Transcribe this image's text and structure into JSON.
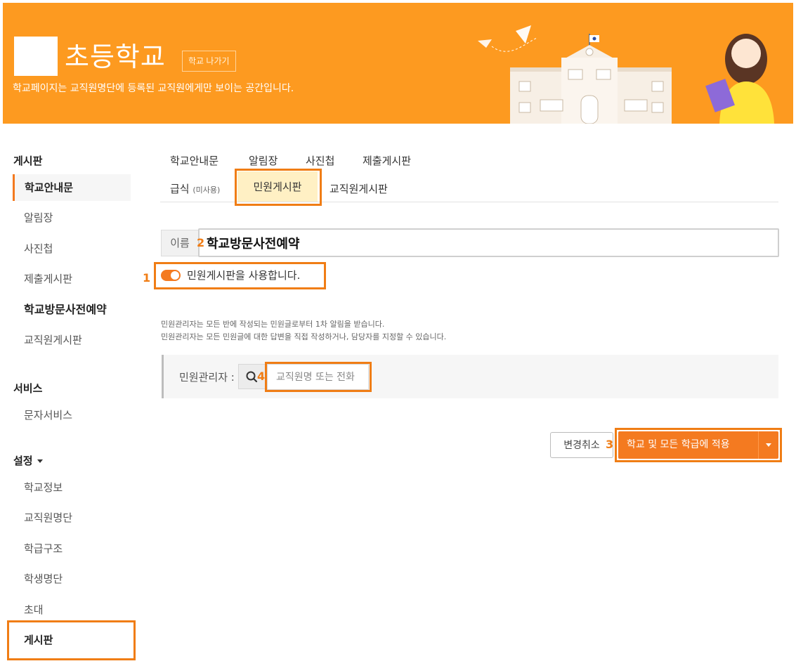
{
  "header": {
    "school_name": "초등학교",
    "exit_button": "학교 나가기",
    "subtitle": "학교페이지는 교직원명단에 등록된 교직원에게만 보이는 공간입니다.",
    "logo_icon": "school-logo-placeholder",
    "illustration": "school-building-teacher-illustration",
    "background_color": "#fd9a20"
  },
  "sidebar": {
    "board_heading": "게시판",
    "board_items": [
      "학교안내문",
      "알림장",
      "사진첩",
      "제출게시판",
      "학교방문사전예약",
      "교직원게시판"
    ],
    "service_heading": "서비스",
    "service_items": [
      "문자서비스"
    ],
    "settings_heading": "설정",
    "settings_items": [
      "학교정보",
      "교직원명단",
      "학급구조",
      "학생명단",
      "초대",
      "게시판"
    ]
  },
  "tabs": {
    "row1": [
      "학교안내문",
      "알림장",
      "사진첩",
      "제출게시판"
    ],
    "meal": "급식",
    "meal_note": "(미사용)",
    "active": "민원게시판",
    "staff": "교직원게시판"
  },
  "form": {
    "name_label": "이름",
    "name_value": "학교방문사전예약",
    "toggle_on": true,
    "toggle_label": "민원게시판을 사용합니다.",
    "help_line1": "민원관리자는 모든 반에 작성되는 민원글로부터 1차 알림을 받습니다.",
    "help_line2": "민원관리자는 모든 민원글에 대한 답변을 직접 작성하거나, 담당자를 지정할 수 있습니다.",
    "admin_label": "민원관리자 :",
    "search_icon": "search-icon",
    "search_placeholder": "교직원명 또는 전화"
  },
  "actions": {
    "cancel": "변경취소",
    "apply": "학교 및 모든 학급에 적용"
  },
  "annotations": {
    "n1": "1",
    "n2": "2",
    "n3": "3",
    "n4": "4",
    "color": "#f07d15"
  }
}
